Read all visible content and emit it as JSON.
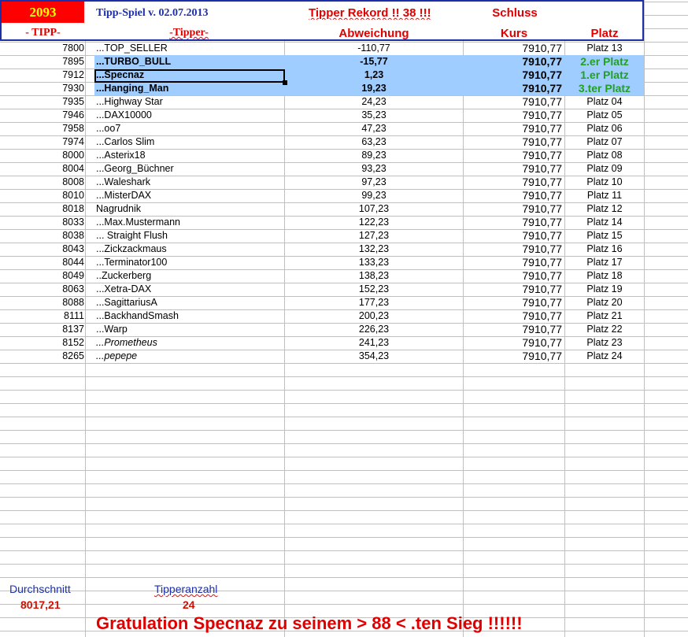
{
  "header": {
    "tipp_number": "2093",
    "title": "Tipp-Spiel v. 02.07.2013",
    "rekord": "Tipper Rekord !!  38  !!!",
    "schluss": "Schluss",
    "col_tipp": "- TIPP-",
    "col_tipper": "-Tipper-",
    "col_abweichung": "Abweichung",
    "col_kurs": "Kurs",
    "col_platz": "Platz"
  },
  "colors": {
    "accent_red": "#ff0000",
    "highlight_blue": "#9fcdff",
    "header_blue": "#1c2fa8",
    "winner_green": "#22a022"
  },
  "rows": [
    {
      "tipp": "7800",
      "name": "...TOP_SELLER",
      "abw": "-110,77",
      "kurs": "7910,77",
      "platz": "Platz 13"
    },
    {
      "tipp": "7895",
      "name": "...TURBO_BULL",
      "abw": "-15,77",
      "kurs": "7910,77",
      "platz": "2.er Platz",
      "hl": true
    },
    {
      "tipp": "7912",
      "name": "...Specnaz",
      "abw": "1,23",
      "kurs": "7910,77",
      "platz": "1.er Platz",
      "hl": true
    },
    {
      "tipp": "7930",
      "name": "...Hanging_Man",
      "abw": "19,23",
      "kurs": "7910,77",
      "platz": "3.ter Platz",
      "hl": true
    },
    {
      "tipp": "7935",
      "name": "...Highway Star",
      "abw": "24,23",
      "kurs": "7910,77",
      "platz": "Platz 04"
    },
    {
      "tipp": "7946",
      "name": "...DAX10000",
      "abw": "35,23",
      "kurs": "7910,77",
      "platz": "Platz 05"
    },
    {
      "tipp": "7958",
      "name": "...oo7",
      "abw": "47,23",
      "kurs": "7910,77",
      "platz": "Platz 06"
    },
    {
      "tipp": "7974",
      "name": "...Carlos Slim",
      "abw": "63,23",
      "kurs": "7910,77",
      "platz": "Platz 07"
    },
    {
      "tipp": "8000",
      "name": "...Asterix18",
      "abw": "89,23",
      "kurs": "7910,77",
      "platz": "Platz 08"
    },
    {
      "tipp": "8004",
      "name": "...Georg_Büchner",
      "abw": "93,23",
      "kurs": "7910,77",
      "platz": "Platz 09"
    },
    {
      "tipp": "8008",
      "name": "...Waleshark",
      "abw": "97,23",
      "kurs": "7910,77",
      "platz": "Platz 10"
    },
    {
      "tipp": "8010",
      "name": "...MisterDAX",
      "abw": "99,23",
      "kurs": "7910,77",
      "platz": "Platz 11"
    },
    {
      "tipp": "8018",
      "name": " Nagrudnik",
      "abw": "107,23",
      "kurs": "7910,77",
      "platz": "Platz 12"
    },
    {
      "tipp": "8033",
      "name": "...Max.Mustermann",
      "abw": "122,23",
      "kurs": "7910,77",
      "platz": "Platz 14"
    },
    {
      "tipp": "8038",
      "name": "... Straight Flush",
      "abw": "127,23",
      "kurs": "7910,77",
      "platz": "Platz 15"
    },
    {
      "tipp": "8043",
      "name": "...Zickzackmaus",
      "abw": "132,23",
      "kurs": "7910,77",
      "platz": "Platz 16"
    },
    {
      "tipp": "8044",
      "name": "...Terminator100",
      "abw": "133,23",
      "kurs": "7910,77",
      "platz": "Platz 17"
    },
    {
      "tipp": "8049",
      "name": "..Zuckerberg",
      "abw": "138,23",
      "kurs": "7910,77",
      "platz": "Platz 18"
    },
    {
      "tipp": "8063",
      "name": "...Xetra-DAX",
      "abw": "152,23",
      "kurs": "7910,77",
      "platz": "Platz 19"
    },
    {
      "tipp": "8088",
      "name": "...SagittariusA",
      "abw": "177,23",
      "kurs": "7910,77",
      "platz": "Platz 20"
    },
    {
      "tipp": "8111",
      "name": "...BackhandSmash",
      "abw": "200,23",
      "kurs": "7910,77",
      "platz": "Platz 21"
    },
    {
      "tipp": "8137",
      "name": "...Warp",
      "abw": "226,23",
      "kurs": "7910,77",
      "platz": "Platz 22"
    },
    {
      "tipp": "8152",
      "name": "...Prometheus",
      "abw": "241,23",
      "kurs": "7910,77",
      "platz": "Platz 23",
      "ital": true
    },
    {
      "tipp": "8265",
      "name": "...pepepe",
      "abw": "354,23",
      "kurs": "7910,77",
      "platz": "Platz 24",
      "ital": true
    }
  ],
  "footer": {
    "durchschnitt_label": "Durchschnitt",
    "durchschnitt_value": "8017,21",
    "tipperanzahl_label": "Tipperanzahl",
    "tipperanzahl_value": "24",
    "gratulation": "Gratulation Specnaz zu seinem > 88 < .ten Sieg !!!!!!"
  }
}
